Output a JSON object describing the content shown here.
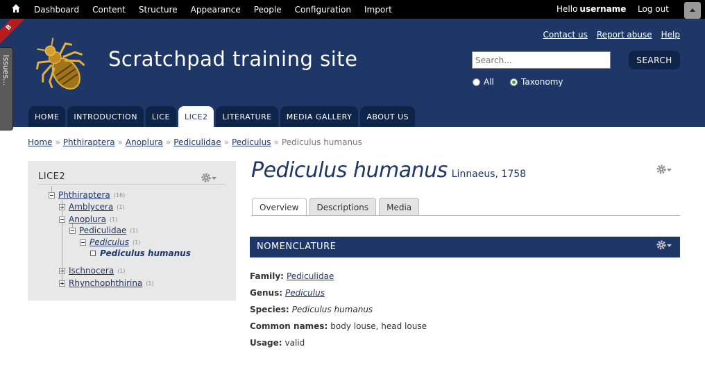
{
  "toolbar": {
    "menu": [
      "Dashboard",
      "Content",
      "Structure",
      "Appearance",
      "People",
      "Configuration",
      "Import"
    ],
    "hello": "Hello",
    "username": "username",
    "logout": "Log out"
  },
  "ribbon": {
    "text": "B"
  },
  "issues_tab": {
    "label": "Issues..."
  },
  "header": {
    "site_name": "Scratchpad training site",
    "secondary_links": [
      "Contact us",
      "Report abuse",
      "Help"
    ],
    "search": {
      "placeholder": "Search...",
      "button": "SEARCH"
    },
    "radio_all": "All",
    "radio_taxonomy": "Taxonomy",
    "radio_selected": "Taxonomy"
  },
  "main_tabs": [
    "HOME",
    "INTRODUCTION",
    "LICE",
    "LICE2",
    "LITERATURE",
    "MEDIA GALLERY",
    "ABOUT US"
  ],
  "active_tab": "LICE2",
  "breadcrumb": [
    "Home",
    "Phthiraptera",
    "Anoplura",
    "Pediculidae",
    "Pediculus"
  ],
  "breadcrumb_current": "Pediculus humanus",
  "breadcrumb_separator": "»",
  "sidebar": {
    "title": "LICE2",
    "tree": {
      "phthiraptera": {
        "label": "Phthiraptera",
        "count": "(16)"
      },
      "amblycera": {
        "label": "Amblycera",
        "count": "(1)"
      },
      "anoplura": {
        "label": "Anoplura",
        "count": "(1)"
      },
      "pediculidae": {
        "label": "Pediculidae",
        "count": "(1)"
      },
      "pediculus": {
        "label": "Pediculus",
        "count": "(1)"
      },
      "pediculus_humanus": {
        "label": "Pediculus humanus"
      },
      "ischnocera": {
        "label": "Ischnocera",
        "count": "(1)"
      },
      "rhynchophthirina": {
        "label": "Rhynchophthirina",
        "count": "(1)"
      }
    }
  },
  "content": {
    "title": "Pediculus humanus",
    "author": "Linnaeus, 1758",
    "tabs": [
      "Overview",
      "Descriptions",
      "Media"
    ],
    "active_tab": "Overview",
    "section_title": "NOMENCLATURE",
    "fields": {
      "family_label": "Family:",
      "family_value": "Pediculidae",
      "genus_label": "Genus:",
      "genus_value": "Pediculus",
      "species_label": "Species:",
      "species_value": "Pediculus humanus",
      "common_label": "Common names:",
      "common_value": "body louse, head louse",
      "usage_label": "Usage:",
      "usage_value": "valid"
    }
  },
  "colors": {
    "navy": "#1e3767",
    "dark_navy": "#0f2449",
    "toolbar": "#000000",
    "sidebar_bg": "#e8e8e8"
  }
}
